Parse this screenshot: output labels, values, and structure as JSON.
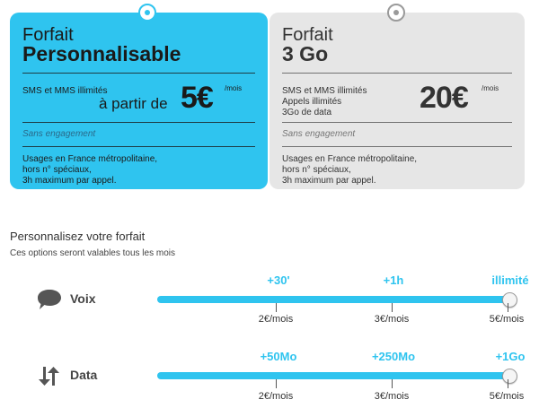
{
  "plans": [
    {
      "title_line1": "Forfait",
      "title_line2": "Personnalisable",
      "features": [
        "SMS et MMS illimités"
      ],
      "price_prefix": "à partir de",
      "price": "5€",
      "price_unit": "/mois",
      "commitment": "Sans engagement",
      "usage_notes": [
        "Usages en France métropolitaine,",
        "hors n° spéciaux,",
        "3h maximum par appel."
      ],
      "color": "#2fc4ef"
    },
    {
      "title_line1": "Forfait",
      "title_line2": "3 Go",
      "features": [
        "SMS et MMS illimités",
        "Appels illimités",
        "3Go de data"
      ],
      "price": "20€",
      "price_unit": "/mois",
      "commitment": "Sans engagement",
      "usage_notes": [
        "Usages en France métropolitaine,",
        "hors n° spéciaux,",
        "3h maximum par appel."
      ],
      "color": "#e6e6e6"
    }
  ],
  "customize": {
    "title": "Personnalisez votre forfait",
    "subtitle": "Ces options seront valables tous les mois"
  },
  "options": [
    {
      "icon": "speech-bubble-icon",
      "label": "Voix",
      "steps": [
        {
          "top": "+30'",
          "bottom": "2€/mois"
        },
        {
          "top": "+1h",
          "bottom": "3€/mois"
        },
        {
          "top": "illimité",
          "bottom": "5€/mois"
        }
      ],
      "selected_step": 3
    },
    {
      "icon": "up-down-arrows-icon",
      "label": "Data",
      "steps": [
        {
          "top": "+50Mo",
          "bottom": "2€/mois"
        },
        {
          "top": "+250Mo",
          "bottom": "3€/mois"
        },
        {
          "top": "+1Go",
          "bottom": "5€/mois"
        }
      ],
      "selected_step": 3
    }
  ],
  "accent_color": "#2fc4ef"
}
